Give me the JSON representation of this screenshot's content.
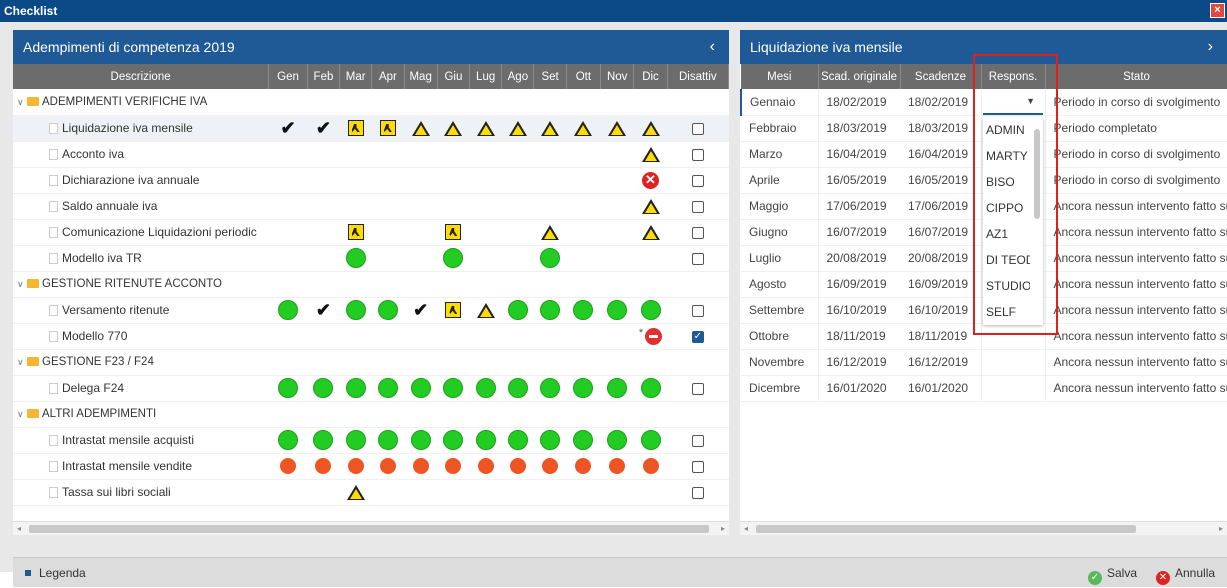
{
  "window": {
    "title": "Checklist"
  },
  "left": {
    "title": "Adempimenti di competenza 2019",
    "columns": [
      "Descrizione",
      "Gen",
      "Feb",
      "Mar",
      "Apr",
      "Mag",
      "Giu",
      "Lug",
      "Ago",
      "Set",
      "Ott",
      "Nov",
      "Dic",
      "Disattiv"
    ],
    "rows": [
      {
        "type": "group",
        "label": "ADEMPIMENTI VERIFICHE IVA",
        "cells": [
          "",
          "",
          "",
          "",
          "",
          "",
          "",
          "",
          "",
          "",
          "",
          ""
        ],
        "checkbox": ""
      },
      {
        "type": "item",
        "label": "Liquidazione iva mensile",
        "selected": true,
        "cells": [
          "check",
          "check",
          "work",
          "work",
          "warn",
          "warn",
          "warn",
          "warn",
          "warn",
          "warn",
          "warn",
          "warn"
        ],
        "checkbox": "off"
      },
      {
        "type": "item",
        "label": "Acconto iva",
        "cells": [
          "",
          "",
          "",
          "",
          "",
          "",
          "",
          "",
          "",
          "",
          "",
          "warn"
        ],
        "checkbox": "off"
      },
      {
        "type": "item",
        "label": "Dichiarazione iva annuale",
        "cells": [
          "",
          "",
          "",
          "",
          "",
          "",
          "",
          "",
          "",
          "",
          "",
          "err"
        ],
        "checkbox": "off"
      },
      {
        "type": "item",
        "label": "Saldo annuale iva",
        "cells": [
          "",
          "",
          "",
          "",
          "",
          "",
          "",
          "",
          "",
          "",
          "",
          "warn"
        ],
        "checkbox": "off"
      },
      {
        "type": "item",
        "label": "Comunicazione Liquidazioni periodic",
        "cells": [
          "",
          "",
          "work",
          "",
          "",
          "work",
          "",
          "",
          "warn",
          "",
          "",
          "warn"
        ],
        "checkbox": "off"
      },
      {
        "type": "item",
        "label": "Modello iva TR",
        "cells": [
          "",
          "",
          "green",
          "",
          "",
          "green",
          "",
          "",
          "green",
          "",
          "",
          ""
        ],
        "checkbox": "off"
      },
      {
        "type": "group",
        "label": "GESTIONE RITENUTE ACCONTO",
        "cells": [
          "",
          "",
          "",
          "",
          "",
          "",
          "",
          "",
          "",
          "",
          "",
          ""
        ],
        "checkbox": ""
      },
      {
        "type": "item",
        "label": "Versamento ritenute",
        "cells": [
          "green",
          "check",
          "green",
          "green",
          "check",
          "work",
          "warn",
          "green",
          "green",
          "green",
          "green",
          "green"
        ],
        "checkbox": "off"
      },
      {
        "type": "item",
        "label": "Modello 770",
        "cells": [
          "",
          "",
          "",
          "",
          "",
          "",
          "",
          "",
          "",
          "",
          "",
          "stop"
        ],
        "checkbox": "on"
      },
      {
        "type": "group",
        "label": "GESTIONE F23 / F24",
        "cells": [
          "",
          "",
          "",
          "",
          "",
          "",
          "",
          "",
          "",
          "",
          "",
          ""
        ],
        "checkbox": ""
      },
      {
        "type": "item",
        "label": "Delega F24",
        "cells": [
          "green",
          "green",
          "green",
          "green",
          "green",
          "green",
          "green",
          "green",
          "green",
          "green",
          "green",
          "green"
        ],
        "checkbox": "off"
      },
      {
        "type": "group",
        "label": "ALTRI ADEMPIMENTI",
        "cells": [
          "",
          "",
          "",
          "",
          "",
          "",
          "",
          "",
          "",
          "",
          "",
          ""
        ],
        "checkbox": ""
      },
      {
        "type": "item",
        "label": "Intrastat mensile acquisti",
        "cells": [
          "green",
          "green",
          "green",
          "green",
          "green",
          "green",
          "green",
          "green",
          "green",
          "green",
          "green",
          "green"
        ],
        "checkbox": "off"
      },
      {
        "type": "item",
        "label": "Intrastat mensile vendite",
        "cells": [
          "orange",
          "orange",
          "orange",
          "orange",
          "orange",
          "orange",
          "orange",
          "orange",
          "orange",
          "orange",
          "orange",
          "orange"
        ],
        "checkbox": "off"
      },
      {
        "type": "item",
        "label": "Tassa sui libri sociali",
        "cells": [
          "",
          "",
          "warn",
          "",
          "",
          "",
          "",
          "",
          "",
          "",
          "",
          ""
        ],
        "checkbox": "off"
      }
    ]
  },
  "right": {
    "title": "Liquidazione iva mensile",
    "columns": [
      "Mesi",
      "Scad. originale",
      "Scadenze",
      "Respons.",
      "Stato"
    ],
    "rows": [
      [
        "Gennaio",
        "18/02/2019",
        "18/02/2019",
        "",
        "Periodo in corso di svolgimento"
      ],
      [
        "Febbraio",
        "18/03/2019",
        "18/03/2019",
        "",
        "Periodo completato"
      ],
      [
        "Marzo",
        "16/04/2019",
        "16/04/2019",
        "",
        "Periodo in corso di svolgimento"
      ],
      [
        "Aprile",
        "16/05/2019",
        "16/05/2019",
        "",
        "Periodo in corso di svolgimento"
      ],
      [
        "Maggio",
        "17/06/2019",
        "17/06/2019",
        "",
        "Ancora nessun intervento fatto sul"
      ],
      [
        "Giugno",
        "16/07/2019",
        "16/07/2019",
        "",
        "Ancora nessun intervento fatto sul"
      ],
      [
        "Luglio",
        "20/08/2019",
        "20/08/2019",
        "",
        "Ancora nessun intervento fatto sul"
      ],
      [
        "Agosto",
        "16/09/2019",
        "16/09/2019",
        "",
        "Ancora nessun intervento fatto sul"
      ],
      [
        "Settembre",
        "16/10/2019",
        "16/10/2019",
        "",
        "Ancora nessun intervento fatto sul"
      ],
      [
        "Ottobre",
        "18/11/2019",
        "18/11/2019",
        "",
        "Ancora nessun intervento fatto sul"
      ],
      [
        "Novembre",
        "16/12/2019",
        "16/12/2019",
        "",
        "Ancora nessun intervento fatto sul"
      ],
      [
        "Dicembre",
        "16/01/2020",
        "16/01/2020",
        "",
        "Ancora nessun intervento fatto sul"
      ]
    ],
    "dropdown_options": [
      "ADMIN",
      "MARTY",
      "BISO",
      "CIPPO",
      "AZ1",
      "DI TEODO",
      "STUDIOB",
      "SELF"
    ]
  },
  "footer": {
    "legend_label": "Legenda",
    "save_label": "Salva",
    "cancel_label": "Annulla"
  },
  "colors": {
    "titlebar": "#0b4a87",
    "panel_header": "#1f5a96",
    "table_header": "#6c6c6c",
    "status_green": "#22cc22",
    "status_orange": "#ee5522",
    "highlight": "#e02020"
  }
}
